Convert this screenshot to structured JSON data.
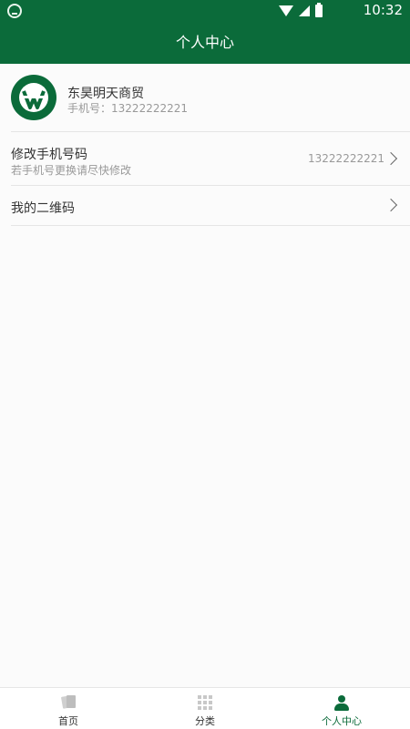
{
  "status_bar": {
    "time": "10:32",
    "app_icon": "app-logo-icon",
    "wifi_icon": "wifi-icon",
    "signal_icon": "signal-icon",
    "battery_icon": "battery-icon"
  },
  "header": {
    "title": "个人中心"
  },
  "profile": {
    "name": "东昊明天商贸",
    "phone_label": "手机号",
    "phone_sep": "：",
    "phone": "13222222221",
    "avatar_icon": "brand-logo-icon"
  },
  "menu": {
    "change_phone": {
      "title": "修改手机号码",
      "subtitle": "若手机号更换请尽快修改",
      "value": "13222222221"
    },
    "qr_code": {
      "title": "我的二维码"
    }
  },
  "bottom_nav": {
    "items": [
      {
        "label": "首页",
        "icon": "home-icon",
        "active": false
      },
      {
        "label": "分类",
        "icon": "grid-icon",
        "active": false
      },
      {
        "label": "个人中心",
        "icon": "user-icon",
        "active": true
      }
    ]
  },
  "colors": {
    "brand_green": "#0b6b3a",
    "text": "#333333",
    "muted": "#999999",
    "divider": "#e5e5e5",
    "background": "#fbfbfb"
  }
}
